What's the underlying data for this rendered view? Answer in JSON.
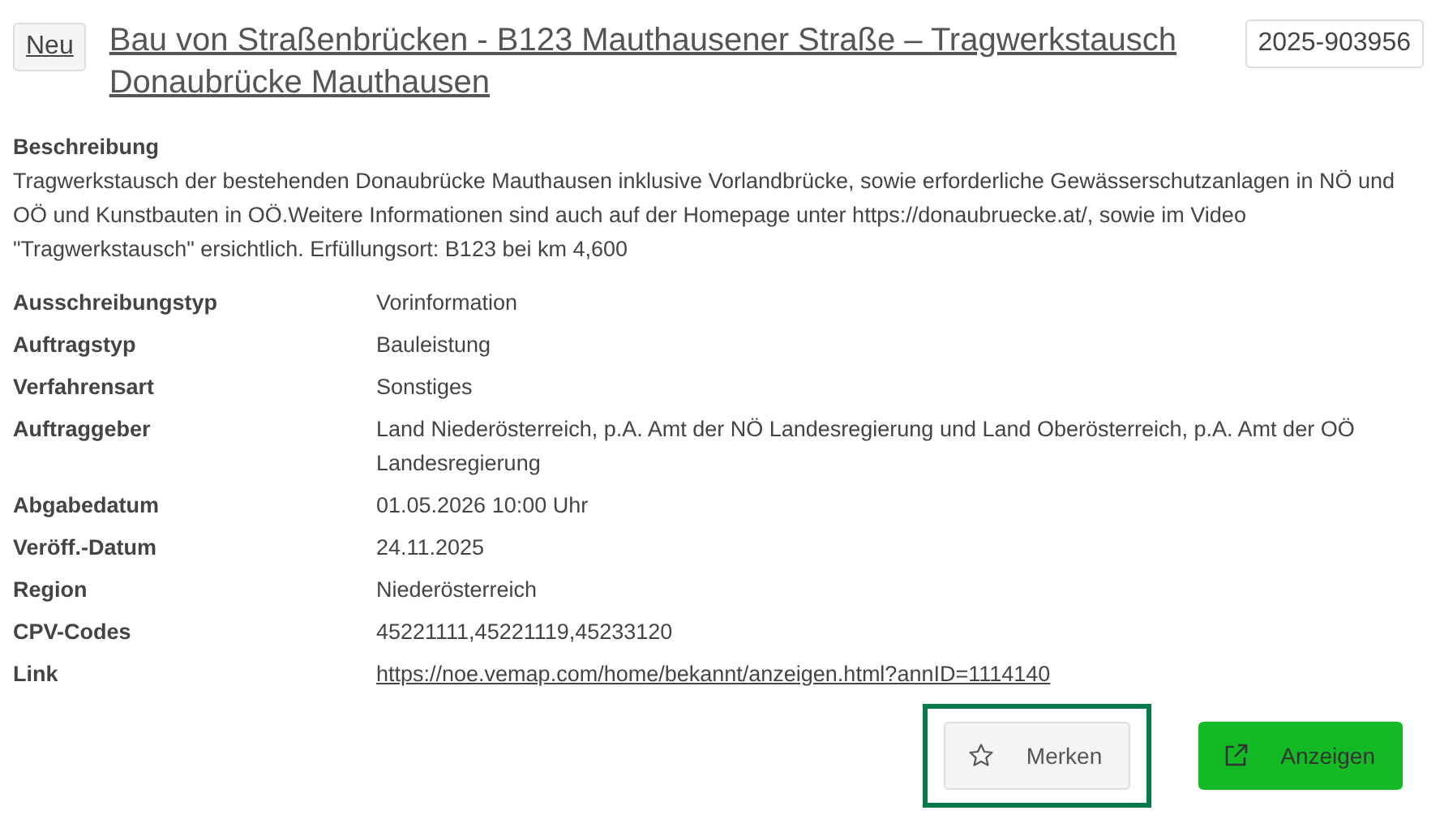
{
  "badge": "Neu",
  "title": "Bau von Straßenbrücken - B123 Mauthausener Straße – Tragwerkstausch Donaubrücke Mauthausen",
  "reference": "2025-903956",
  "description": {
    "label": "Beschreibung",
    "text": "Tragwerkstausch der bestehenden Donaubrücke Mauthausen inklusive Vorlandbrücke, sowie erforderliche Gewässerschutzanlagen in NÖ und OÖ und Kunstbauten in OÖ.Weitere Informationen sind auch auf der Homepage unter https://donaubruecke.at/, sowie im Video \"Tragwerkstausch\" ersichtlich. Erfüllungsort: B123 bei km 4,600"
  },
  "fields": [
    {
      "label": "Ausschreibungstyp",
      "value": "Vorinformation",
      "kind": "text"
    },
    {
      "label": "Auftragstyp",
      "value": "Bauleistung",
      "kind": "text"
    },
    {
      "label": "Verfahrensart",
      "value": "Sonstiges",
      "kind": "text"
    },
    {
      "label": "Auftraggeber",
      "value": "Land Niederösterreich, p.A. Amt der NÖ Landesregierung und Land Oberösterreich, p.A. Amt der OÖ Landesregierung",
      "kind": "text"
    },
    {
      "label": "Abgabedatum",
      "value": "01.05.2026 10:00 Uhr",
      "kind": "text"
    },
    {
      "label": "Veröff.-Datum",
      "value": "24.11.2025",
      "kind": "text"
    },
    {
      "label": "Region",
      "value": "Niederösterreich",
      "kind": "text"
    },
    {
      "label": "CPV-Codes",
      "value": "45221111,45221119,45233120",
      "kind": "text"
    },
    {
      "label": "Link",
      "value": "https://noe.vemap.com/home/bekannt/anzeigen.html?annID=1114140",
      "kind": "link"
    }
  ],
  "buttons": [
    {
      "label": "Merken",
      "kind": "bookmark",
      "focused": true
    },
    {
      "label": "Anzeigen",
      "kind": "open",
      "focused": false
    }
  ]
}
